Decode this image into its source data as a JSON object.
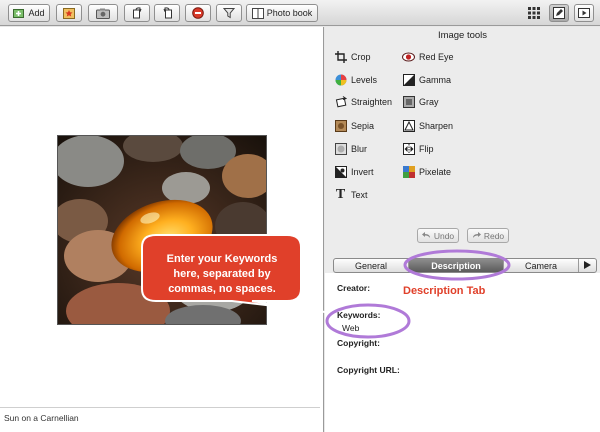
{
  "toolbar": {
    "add_label": "Add",
    "photobook_label": "Photo book",
    "icons": [
      "add-photo-icon",
      "favorite-icon",
      "camera-icon",
      "rotate-left-icon",
      "rotate-right-icon",
      "delete-icon",
      "filter-icon",
      "photo-book-icon",
      "grid-view-icon",
      "edit-icon",
      "slideshow-icon"
    ]
  },
  "photo": {
    "caption": "Sun on a Carnellian"
  },
  "image_tools": {
    "title": "Image tools",
    "left": [
      "Crop",
      "Levels",
      "Straighten",
      "Sepia",
      "Blur",
      "Invert",
      "Text"
    ],
    "right": [
      "Red Eye",
      "Gamma",
      "Gray",
      "Sharpen",
      "Flip",
      "Pixelate"
    ],
    "undo": "Undo",
    "redo": "Redo"
  },
  "tabs": {
    "general": "General",
    "description": "Description",
    "camera": "Camera",
    "active": "Description"
  },
  "fields": {
    "creator_label": "Creator:",
    "keywords_label": "Keywords:",
    "keywords_value": "Web",
    "copyright_label": "Copyright:",
    "copyright_url_label": "Copyright URL:"
  },
  "annotations": {
    "bubble_line1": "Enter your Keywords",
    "bubble_line2": "here, separated by",
    "bubble_line3": "commas, no spaces.",
    "description_tab_note": "Description Tab",
    "color": "#e0402a"
  }
}
